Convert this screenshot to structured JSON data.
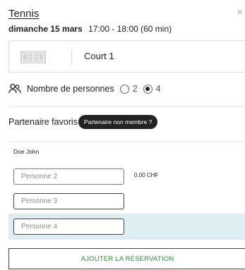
{
  "header": {
    "title": "Tennis",
    "close_symbol": "×",
    "date": "dimanche 15 mars",
    "time": "17:00 - 18:00 (60 min)"
  },
  "court": {
    "icon": "court-icon",
    "name": "Court 1"
  },
  "persons": {
    "icon": "people-icon",
    "label": "Nombre de personnes",
    "options": [
      {
        "label": "2",
        "selected": false
      },
      {
        "label": "4",
        "selected": true
      }
    ]
  },
  "favorites": {
    "label": "Partenaire favoris :",
    "non_member_button": "Partenaire non membre ?"
  },
  "players": {
    "owner": "Doe John",
    "inputs": [
      {
        "placeholder": "Personne 2",
        "price": "0.00 CHF",
        "state": "error"
      },
      {
        "placeholder": "Personne 3",
        "price": "",
        "state": "default"
      },
      {
        "placeholder": "Personne 4",
        "price": "",
        "state": "highlighted"
      }
    ]
  },
  "actions": {
    "submit_label": "AJOUTER LA RÉSERVATION"
  },
  "colors": {
    "accent_green": "#2e8b3a",
    "error_red": "#d9534f",
    "highlight_row": "#deedf4",
    "pill_bg": "#222222"
  }
}
